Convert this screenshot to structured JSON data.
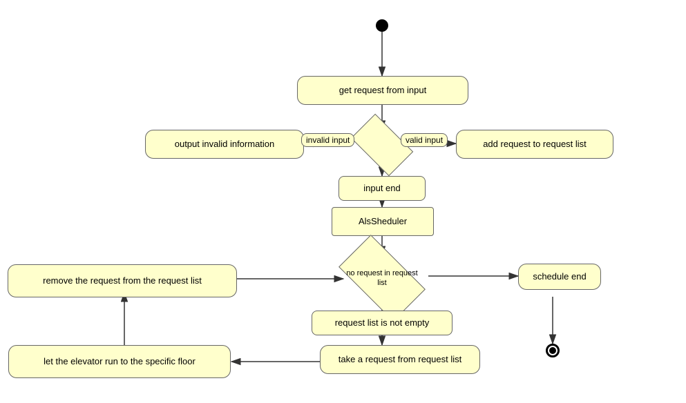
{
  "nodes": {
    "start": {
      "label": ""
    },
    "get_request": {
      "label": "get request from input"
    },
    "decision_input": {
      "label": ""
    },
    "output_invalid": {
      "label": "output invalid information"
    },
    "add_request": {
      "label": "add request to request list"
    },
    "input_end": {
      "label": "input end"
    },
    "als_scheduler": {
      "label": "AlsSheduler"
    },
    "decision_request": {
      "label": "no request\nin request list"
    },
    "schedule_end": {
      "label": "schedule end"
    },
    "request_not_empty": {
      "label": "request list is not empty"
    },
    "take_request": {
      "label": "take a request from request list"
    },
    "let_elevator": {
      "label": "let the elevator run to the specific floor"
    },
    "remove_request": {
      "label": "remove the request from the request list"
    },
    "end": {
      "label": ""
    }
  },
  "edge_labels": {
    "invalid_input": "invalid input",
    "valid_input": "valid input"
  },
  "colors": {
    "node_fill": "#ffffcc",
    "node_border": "#666666",
    "arrow": "#333333",
    "text": "#000000"
  }
}
